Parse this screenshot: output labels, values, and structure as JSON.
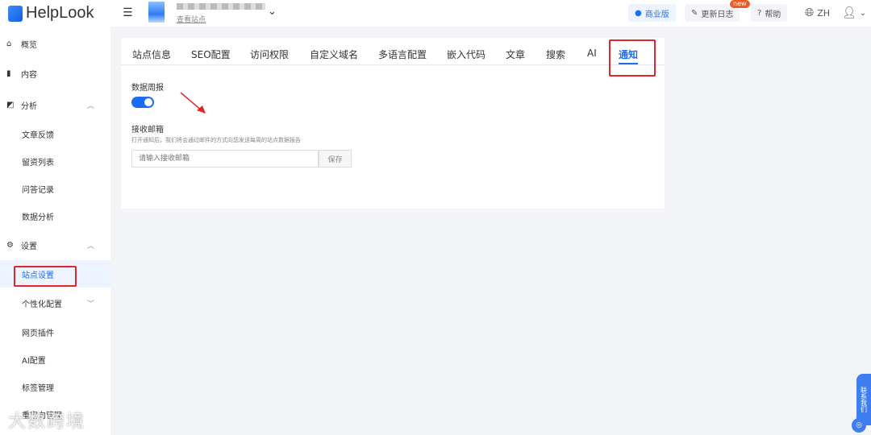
{
  "header": {
    "logo": "HelpLook",
    "site_link": "查看站点",
    "business": "商业版",
    "changelog": "更新日志",
    "new_badge": "new",
    "help": "帮助",
    "lang": "ZH"
  },
  "sidebar": {
    "items": [
      {
        "label": "概览",
        "icon": "home-icon"
      },
      {
        "label": "内容",
        "icon": "book-icon"
      },
      {
        "label": "分析",
        "icon": "chart-icon"
      },
      {
        "label": "文章反馈"
      },
      {
        "label": "留资列表"
      },
      {
        "label": "问答记录"
      },
      {
        "label": "数据分析"
      },
      {
        "label": "设置",
        "icon": "gear-icon"
      },
      {
        "label": "站点设置"
      },
      {
        "label": "个性化配置"
      },
      {
        "label": "网页插件"
      },
      {
        "label": "AI配置"
      },
      {
        "label": "标签管理"
      },
      {
        "label": "重定向管理"
      }
    ]
  },
  "tabs": [
    "站点信息",
    "SEO配置",
    "访问权限",
    "自定义域名",
    "多语言配置",
    "嵌入代码",
    "文章",
    "搜索",
    "AI",
    "通知"
  ],
  "notify": {
    "weekly_label": "数据周报",
    "weekly_enabled": true,
    "email_label": "接收邮箱",
    "hint": "打开通知后，我们将会通过邮件的方式向您发送每周的站点数据报告",
    "email_placeholder": "请输入接收邮箱",
    "email_value": "",
    "save": "保存"
  },
  "contact": "联系我们",
  "watermark": "大数跨境",
  "colors": {
    "accent": "#1d6cf5",
    "highlight": "#e0262b"
  }
}
